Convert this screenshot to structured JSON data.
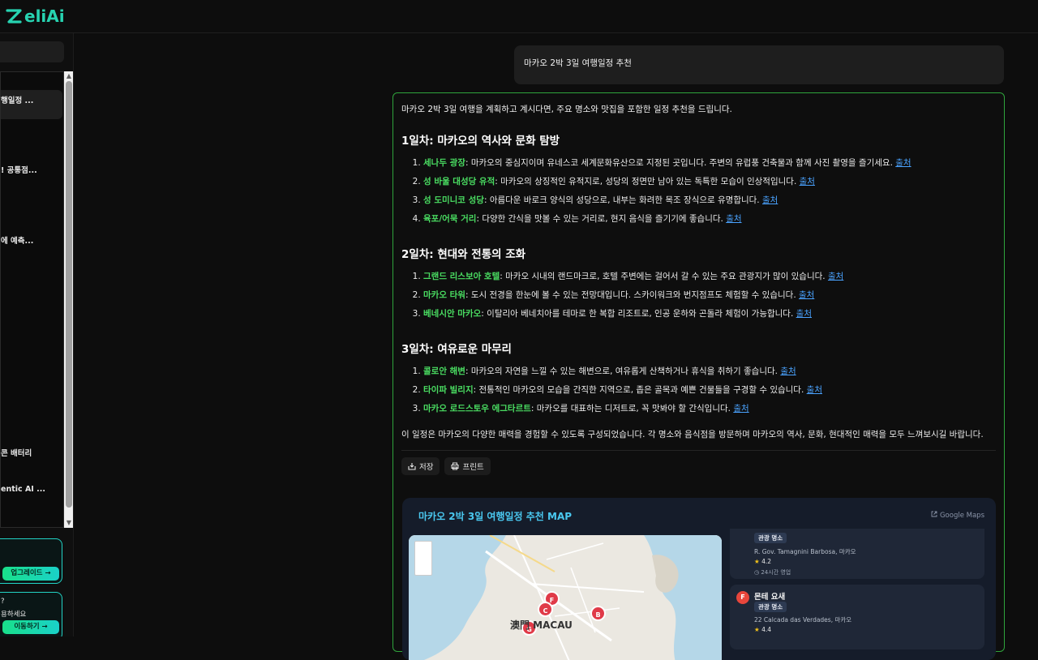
{
  "app": {
    "logo": "ZeliAi"
  },
  "sidebar": {
    "items": [
      {
        "label": "행일정 ..."
      },
      {
        "label": "! 공통점..."
      },
      {
        "label": "에 예측..."
      },
      {
        "label": "콘 배터리"
      },
      {
        "label": "entic AI ..."
      }
    ],
    "promo1": {
      "button": "업그레이드 →"
    },
    "promo2": {
      "line1": "?",
      "line2": "용하세요",
      "button": "이동하기 →"
    }
  },
  "chat": {
    "user_message": "마카오 2박 3일 여행일정 추천",
    "answer": {
      "intro": "마카오 2박 3일 여행을 계획하고 계시다면, 주요 명소와 맛집을 포함한 일정 추천을 드립니다.",
      "source_label": "출처",
      "days": [
        {
          "title": "1일차: 마카오의 역사와 문화 탐방",
          "items": [
            {
              "name": "세나두 광장",
              "desc": ": 마카오의 중심지이며 유네스코 세계문화유산으로 지정된 곳입니다. 주변의 유럽풍 건축물과 함께 사진 촬영을 즐기세요. "
            },
            {
              "name": "성 바울 대성당 유적",
              "desc": ": 마카오의 상징적인 유적지로, 성당의 정면만 남아 있는 독특한 모습이 인상적입니다. "
            },
            {
              "name": "성 도미니코 성당",
              "desc": ": 아름다운 바로크 양식의 성당으로, 내부는 화려한 목조 장식으로 유명합니다. "
            },
            {
              "name": "육포/어묵 거리",
              "desc": ": 다양한 간식을 맛볼 수 있는 거리로, 현지 음식을 즐기기에 좋습니다. "
            }
          ]
        },
        {
          "title": "2일차: 현대와 전통의 조화",
          "items": [
            {
              "name": "그랜드 리스보아 호텔",
              "desc": ": 마카오 시내의 랜드마크로, 호텔 주변에는 걸어서 갈 수 있는 주요 관광지가 많이 있습니다. "
            },
            {
              "name": "마카오 타워",
              "desc": ": 도시 전경을 한눈에 볼 수 있는 전망대입니다. 스카이워크와 번지점프도 체험할 수 있습니다. "
            },
            {
              "name": "베네시안 마카오",
              "desc": ": 이탈리아 베네치아를 테마로 한 복합 리조트로, 인공 운하와 곤돌라 체험이 가능합니다. "
            }
          ]
        },
        {
          "title": "3일차: 여유로운 마무리",
          "items": [
            {
              "name": "콜로안 해변",
              "desc": ": 마카오의 자연을 느낄 수 있는 해변으로, 여유롭게 산책하거나 휴식을 취하기 좋습니다. "
            },
            {
              "name": "타이파 빌리지",
              "desc": ": 전통적인 마카오의 모습을 간직한 지역으로, 좁은 골목과 예쁜 건물들을 구경할 수 있습니다. "
            },
            {
              "name": "마카오 로드스토우 에그타르트",
              "desc": ": 마카오를 대표하는 디저트로, 꼭 맛봐야 할 간식입니다. "
            }
          ]
        }
      ],
      "outro": "이 일정은 마카오의 다양한 매력을 경험할 수 있도록 구성되었습니다. 각 명소와 음식점을 방문하며 마카오의 역사, 문화, 현대적인 매력을 모두 느껴보시길 바랍니다.",
      "actions": {
        "save": "저장",
        "print": "프린트"
      }
    },
    "map": {
      "title": "마카오 2박 3일 여행일정 추천 MAP",
      "google_maps": "Google Maps",
      "map_label": "澳門 MACAU",
      "pins": [
        "F",
        "C",
        "B",
        "G"
      ],
      "pois": [
        {
          "tag": "관광 명소",
          "address": "R. Gov. Tamagnini Barbosa, 마카오",
          "rating": "4.2",
          "hours": "24시간 영업"
        },
        {
          "icon": "F",
          "name": "몬테 요새",
          "tag": "관광 명소",
          "address": "22 Calcada das Verdades, 마카오",
          "rating": "4.4"
        }
      ]
    }
  }
}
